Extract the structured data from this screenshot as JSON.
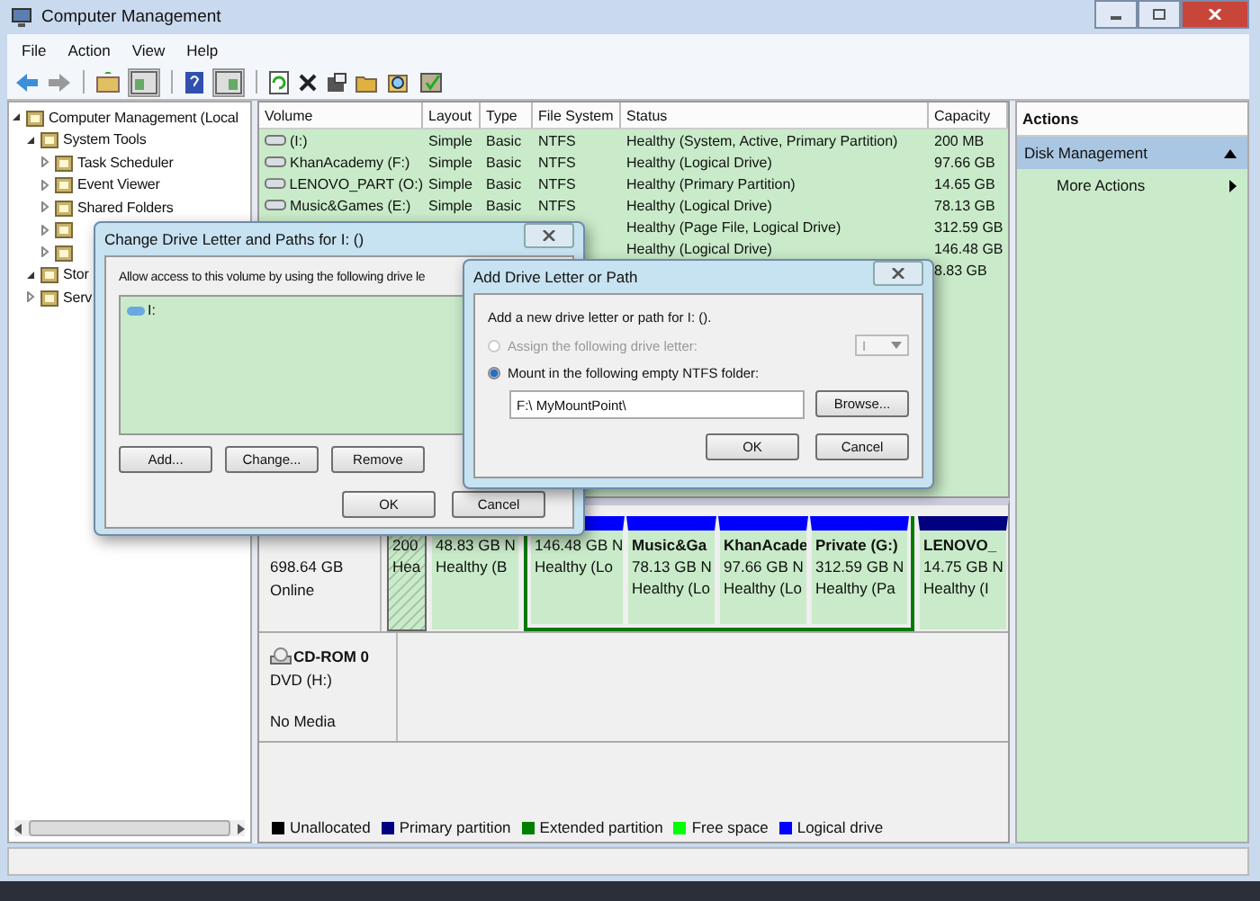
{
  "window": {
    "title": "Computer Management"
  },
  "menu": [
    "File",
    "Action",
    "View",
    "Help"
  ],
  "tree": [
    {
      "label": "Computer Management (Local",
      "expanded": true,
      "children": [
        {
          "label": "System Tools",
          "expanded": true,
          "children": [
            {
              "label": "Task Scheduler",
              "expanded": false
            },
            {
              "label": "Event Viewer",
              "expanded": false
            },
            {
              "label": "Shared Folders",
              "expanded": false
            },
            {
              "expanded": false
            },
            {
              "expanded": false
            }
          ]
        },
        {
          "label": "Stor",
          "expanded": true
        },
        {
          "label": "Serv",
          "expanded": false
        }
      ]
    }
  ],
  "volumes": {
    "columns": [
      "Volume",
      "Layout",
      "Type",
      "File System",
      "Status",
      "Capacity"
    ],
    "rows": [
      {
        "volume": "(I:)",
        "layout": "Simple",
        "type": "Basic",
        "fs": "NTFS",
        "status": "Healthy (System, Active, Primary Partition)",
        "capacity": "200 MB"
      },
      {
        "volume": "KhanAcademy (F:)",
        "layout": "Simple",
        "type": "Basic",
        "fs": "NTFS",
        "status": "Healthy (Logical Drive)",
        "capacity": "97.66 GB"
      },
      {
        "volume": "LENOVO_PART (O:)",
        "layout": "Simple",
        "type": "Basic",
        "fs": "NTFS",
        "status": "Healthy (Primary Partition)",
        "capacity": "14.65 GB"
      },
      {
        "volume": "Music&Games (E:)",
        "layout": "Simple",
        "type": "Basic",
        "fs": "NTFS",
        "status": "Healthy (Logical Drive)",
        "capacity": "78.13 GB"
      },
      {
        "status": "Healthy (Page File, Logical Drive)",
        "capacity": "312.59 GB"
      },
      {
        "status": "Healthy (Logical Drive)",
        "capacity": "146.48 GB"
      },
      {
        "capacity": "8.83 GB"
      }
    ]
  },
  "disks": [
    {
      "kind": "hard",
      "size": "698.64 GB",
      "status": "Online",
      "partitions": [
        {
          "kind": "primary",
          "size": "200",
          "status": "Hea",
          "selected": true
        },
        {
          "kind": "primary",
          "size": "48.83 GB N",
          "status": "Healthy (B",
          "selected": false
        },
        {
          "kind": "extended",
          "children": [
            {
              "kind": "logical",
              "size": "146.48 GB N",
              "status": "Healthy (Lo",
              "selected": false
            },
            {
              "kind": "logical",
              "name": "Music&Ga",
              "size": "78.13 GB N",
              "status": "Healthy (Lo",
              "selected": false
            },
            {
              "kind": "logical",
              "name": "KhanAcade",
              "size": "97.66 GB N",
              "status": "Healthy (Lo",
              "selected": false
            },
            {
              "kind": "logical",
              "name": "Private  (G:)",
              "size": "312.59 GB N",
              "status": "Healthy (Pa",
              "selected": false
            }
          ]
        },
        {
          "kind": "primary",
          "name": "LENOVO_",
          "size": "14.75 GB N",
          "status": "Healthy (I",
          "selected": false
        }
      ]
    },
    {
      "kind": "cdrom",
      "name": "CD-ROM 0",
      "type": "DVD (H:)",
      "status": "No Media"
    }
  ],
  "legend": [
    {
      "label": "Unallocated",
      "color": "#000000"
    },
    {
      "label": "Primary partition",
      "color": "#000080"
    },
    {
      "label": "Extended partition",
      "color": "#008000"
    },
    {
      "label": "Free space",
      "color": "#00ff00"
    },
    {
      "label": "Logical drive",
      "color": "#0000ff"
    }
  ],
  "actions": {
    "title": "Actions",
    "items": [
      {
        "kind": "section",
        "label": "Disk Management",
        "expanded": true
      },
      {
        "kind": "submenu",
        "label": "More Actions"
      }
    ]
  },
  "change_dialog": {
    "title": "Change Drive Letter and Paths for I: ()",
    "text": "Allow access to this volume by using the following drive le",
    "items": [
      {
        "label": "I:",
        "selected": false
      }
    ],
    "buttons": [
      "Add...",
      "Change...",
      "Remove"
    ],
    "footer": [
      "OK",
      "Cancel"
    ]
  },
  "add_dialog": {
    "title": "Add Drive Letter or Path",
    "text": "Add a new drive letter or path for I: ().",
    "options": [
      {
        "label": "Assign the following drive letter:",
        "selected": false,
        "disabled": true,
        "kind": "letter",
        "value": "I"
      },
      {
        "label": "Mount in the following empty NTFS folder:",
        "selected": true,
        "disabled": false,
        "kind": "folder",
        "value": "F:\\ MyMountPoint\\",
        "button": "Browse..."
      }
    ],
    "footer": [
      "OK",
      "Cancel"
    ]
  }
}
